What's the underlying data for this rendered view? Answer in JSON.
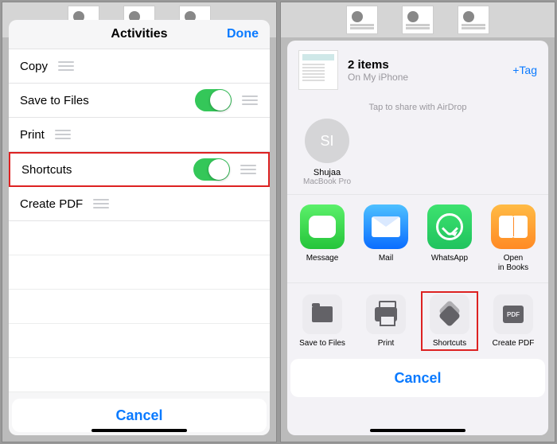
{
  "left": {
    "title": "Activities",
    "done": "Done",
    "rows": {
      "copy": "Copy",
      "save": "Save to Files",
      "print": "Print",
      "shortcuts": "Shortcuts",
      "createpdf": "Create PDF"
    },
    "cancel": "Cancel"
  },
  "right": {
    "items_title": "2 items",
    "items_sub": "On My iPhone",
    "tag": "+Tag",
    "airdrop_label": "Tap to share with AirDrop",
    "contact": {
      "initials": "SI",
      "name": "Shujaa",
      "device": "MacBook Pro"
    },
    "apps": {
      "message": "Message",
      "mail": "Mail",
      "whatsapp": "WhatsApp",
      "books": "Open\nin Books"
    },
    "actions": {
      "save": "Save to Files",
      "print": "Print",
      "shortcuts": "Shortcuts",
      "createpdf": "Create PDF"
    },
    "cancel": "Cancel"
  }
}
